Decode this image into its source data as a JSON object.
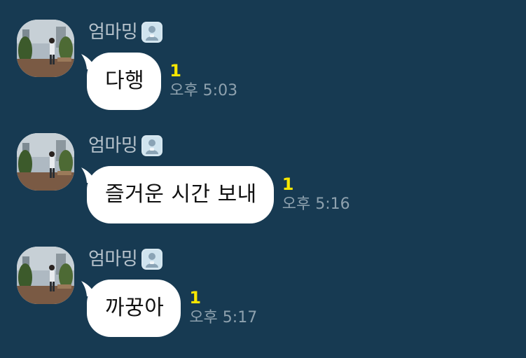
{
  "chat": {
    "messages": [
      {
        "sender": "엄마밍",
        "text": "다행",
        "unread": "1",
        "time": "오후 5:03",
        "sender_badge_icon": "person-badge-icon",
        "avatar_icon": "profile-photo"
      },
      {
        "sender": "엄마밍",
        "text": "즐거운 시간 보내",
        "unread": "1",
        "time": "오후 5:16",
        "sender_badge_icon": "person-badge-icon",
        "avatar_icon": "profile-photo"
      },
      {
        "sender": "엄마밍",
        "text": "까꿍아",
        "unread": "1",
        "time": "오후 5:17",
        "sender_badge_icon": "person-badge-icon",
        "avatar_icon": "profile-photo"
      }
    ]
  },
  "colors": {
    "background": "#173a52",
    "bubble": "#ffffff",
    "unread": "#f7e600",
    "time": "#8ea1ae",
    "sender": "#b7c3cc"
  }
}
